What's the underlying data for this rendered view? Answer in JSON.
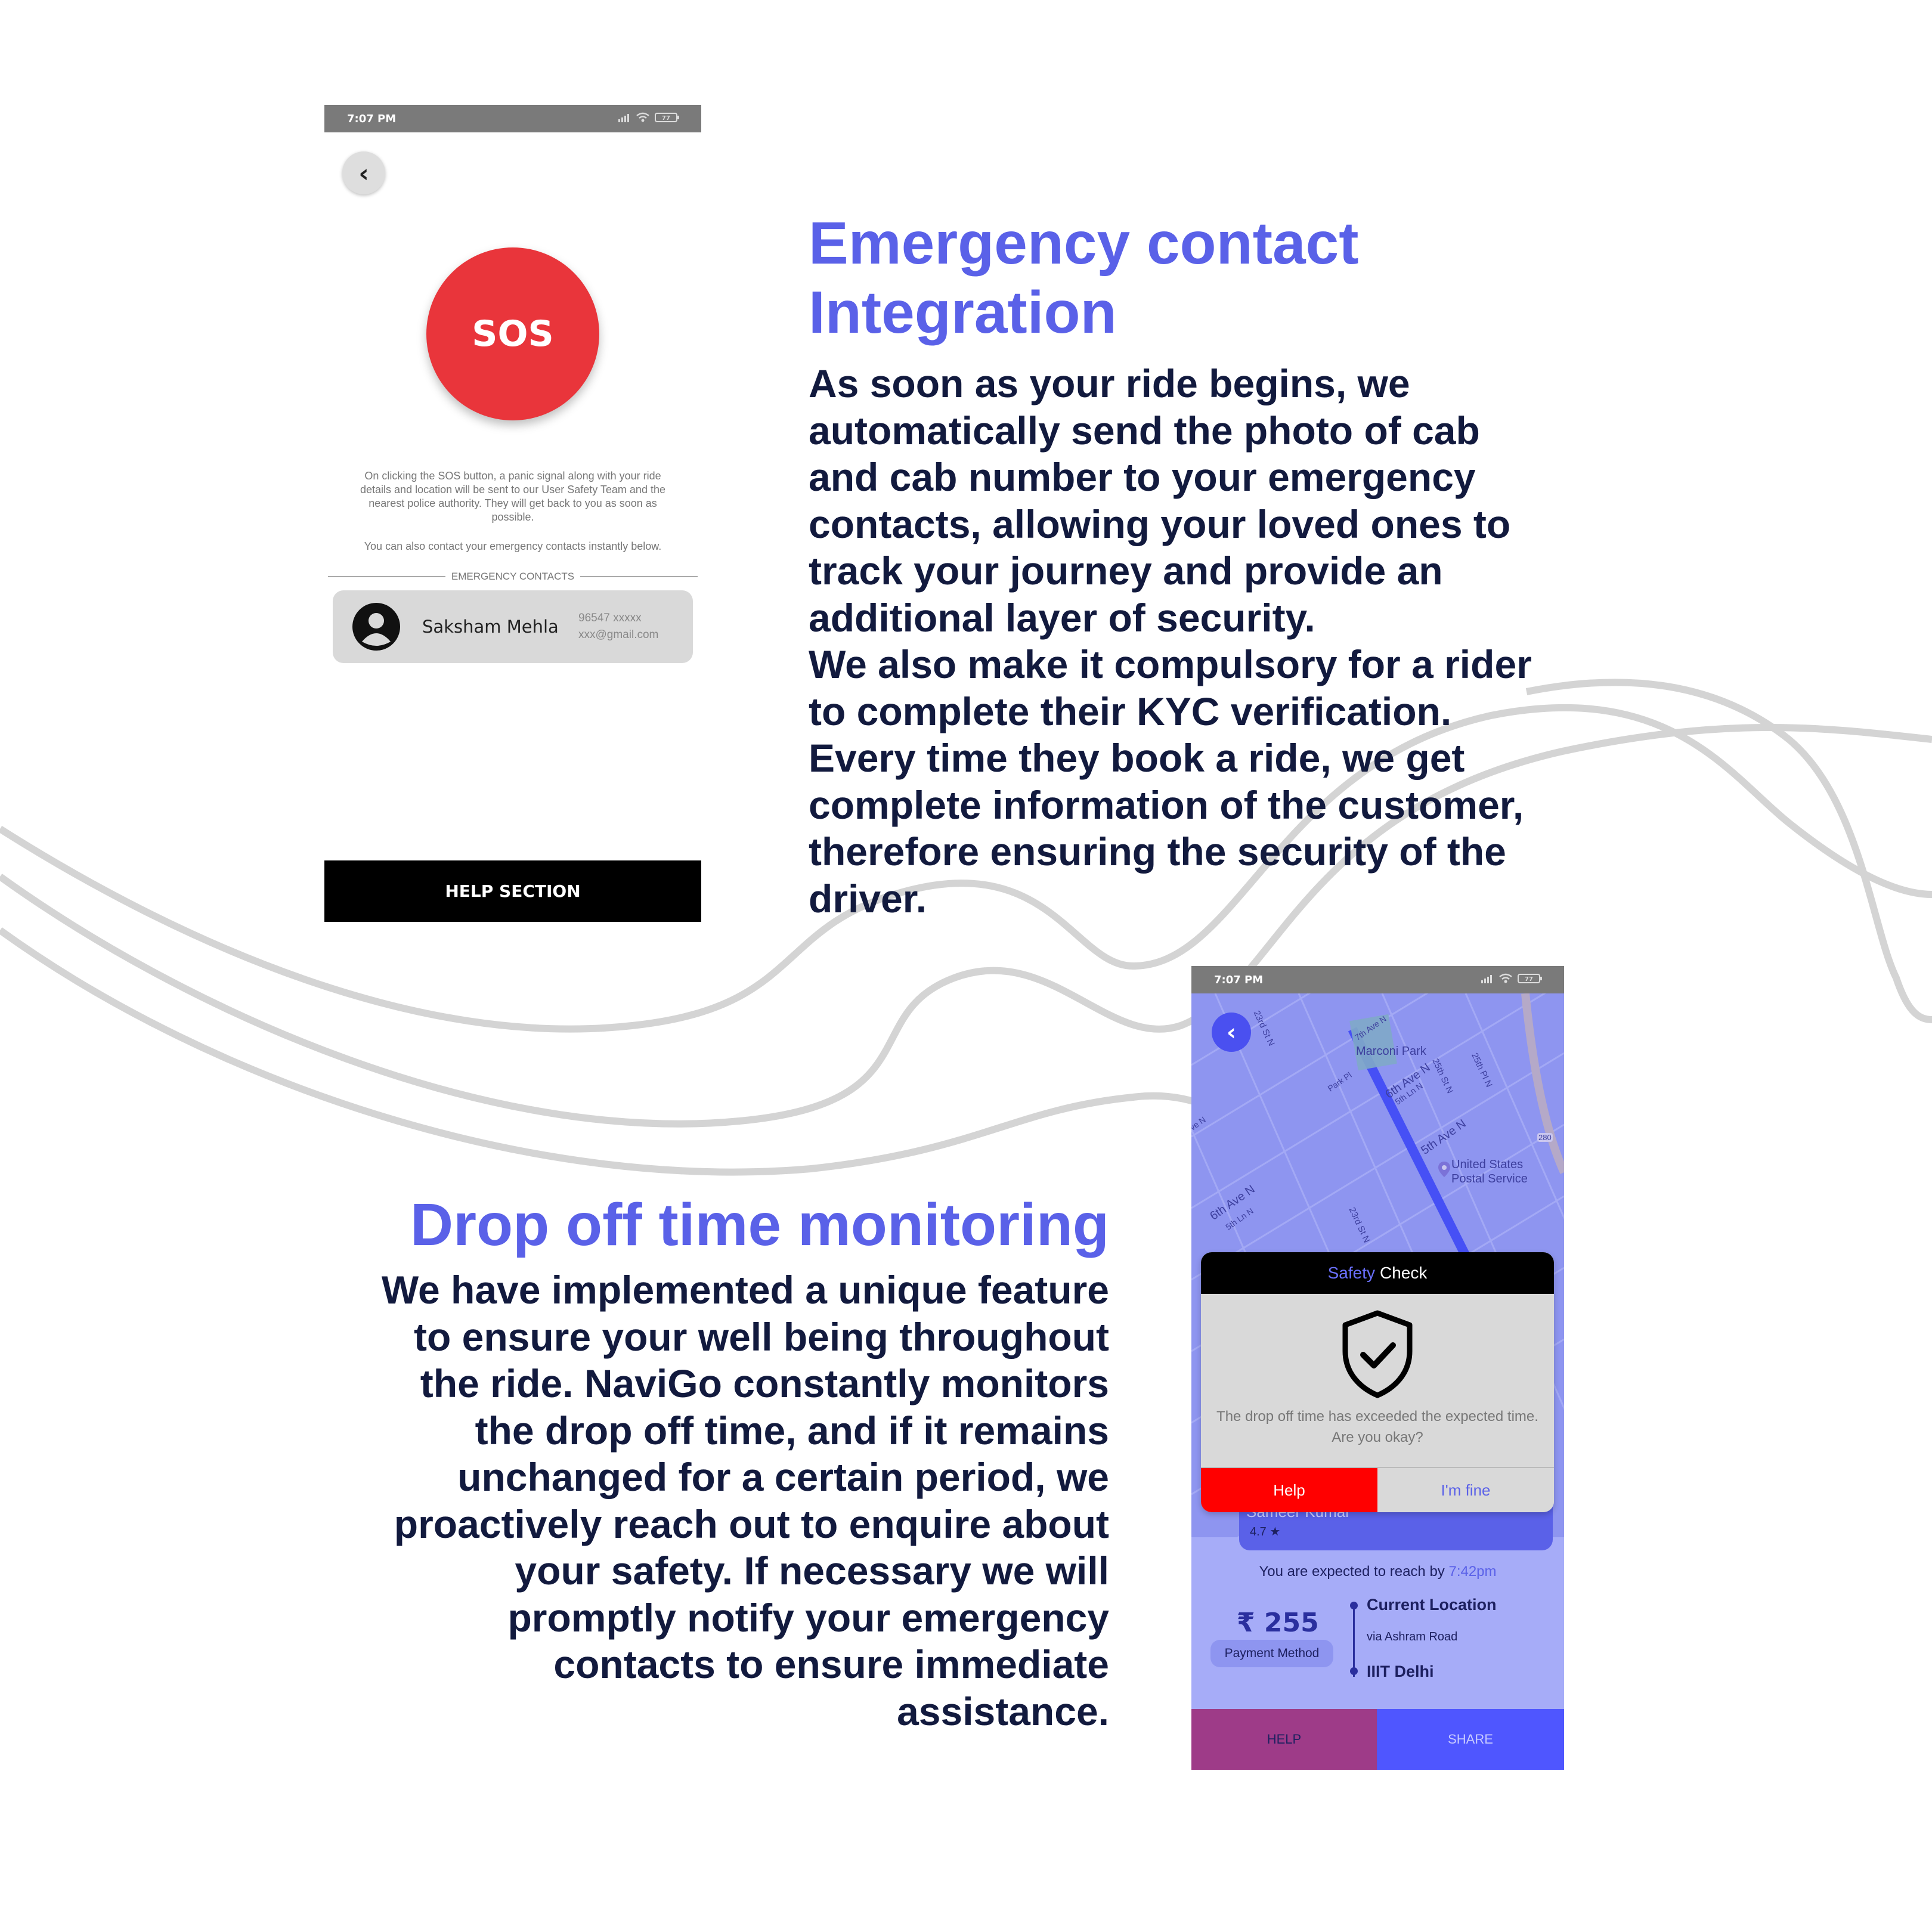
{
  "sos_screen": {
    "status_time": "7:07 PM",
    "battery": "77",
    "back_icon": "chevron-left-icon",
    "sos_label": "SOS",
    "description": "On clicking the SOS button, a panic signal along with your ride details and location will be sent to our User Safety Team and the nearest police authority. They will get back to you as soon as possible.",
    "description_secondary": "You can also contact your emergency contacts instantly below.",
    "emergency_contacts_label": "EMERGENCY CONTACTS",
    "contact": {
      "avatar_icon": "user-avatar-icon",
      "name": "Saksham Mehla",
      "phone": "96547 xxxxx",
      "email": "xxx@gmail.com"
    },
    "help_section_label": "HELP SECTION",
    "sos_color": "#e9353b"
  },
  "section_1": {
    "heading_line1": "Emergency contact",
    "heading_line2": "Integration",
    "body_lines": [
      "As soon as your ride begins, we",
      "automatically send the photo of cab",
      "and cab number to your emergency",
      "contacts, allowing your loved ones to",
      "track your journey and provide an",
      "additional layer of security.",
      "We also make it compulsory for a rider",
      "to complete their KYC verification.",
      "Every time they book a ride, we get",
      "complete information of the customer,",
      "therefore ensuring the security of the",
      "driver."
    ]
  },
  "section_2": {
    "heading": "Drop off time monitoring",
    "body_lines": [
      "We have implemented a unique feature",
      "to ensure your well being throughout",
      "the ride. NaviGo constantly monitors",
      "the drop off time, and if it remains",
      "unchanged for a certain period, we",
      "proactively reach out to enquire about",
      "your safety. If necessary we will",
      "promptly notify your emergency",
      "contacts to ensure immediate",
      "assistance."
    ]
  },
  "map_screen": {
    "status_time": "7:07 PM",
    "battery": "77",
    "map_labels": {
      "marconi_park": "Marconi Park",
      "postal": "United States",
      "postal2": "Postal Service",
      "ave_6th_a": "6th Ave N",
      "ave_6th_b": "6th Ave N",
      "ave_5th": "5th Ave N",
      "ave_7th": "7th Ave N",
      "ln_5th_a": "5th Ln N",
      "ln_5th_b": "5th Ln N",
      "park_pl": "Park Pl",
      "st_23rd_a": "23rd St N",
      "st_23rd_b": "23rd St N",
      "st_25th": "25th St N",
      "pl_25th": "25th Pl N",
      "highway": "280",
      "ave_edge": "ve N"
    },
    "safety_check": {
      "title_accent": "Safety",
      "title_rest": "Check",
      "shield_icon": "shield-check-icon",
      "message_line1": "The drop off time has exceeded the expected time.",
      "message_line2": "Are you okay?",
      "help_label": "Help",
      "fine_label": "I'm fine"
    },
    "driver": {
      "name": "Sameer Kumar",
      "rating": "4.7 ★"
    },
    "expected_prefix": "You are expected to reach by",
    "expected_time": "7:42pm",
    "fare": "₹ 255",
    "payment_method": "Payment Method",
    "current_location": "Current Location",
    "via": "via Ashram Road",
    "destination": "IIIT Delhi",
    "bottom_help": "HELP",
    "bottom_share": "SHARE",
    "accent_color": "#5a61e8"
  }
}
